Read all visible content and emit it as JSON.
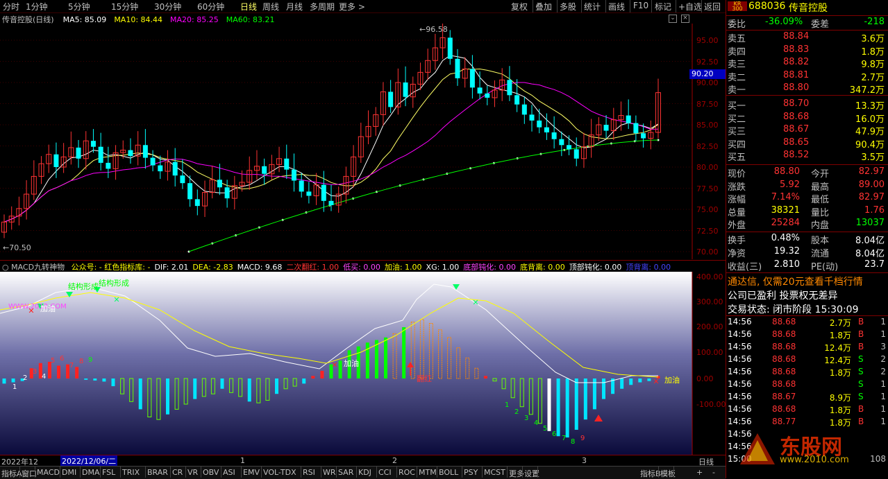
{
  "menu": {
    "periods": [
      "分时",
      "1分钟",
      "5分钟",
      "15分钟",
      "30分钟",
      "60分钟",
      "日线",
      "周线",
      "月线",
      "多周期",
      "更多 >"
    ],
    "active": "日线",
    "right_buttons": [
      "复权",
      "叠加",
      "多股",
      "统计",
      "画线",
      "F10",
      "标记",
      "+自选",
      "返回"
    ]
  },
  "main_chart": {
    "title": "传音控股(日线)",
    "ma": [
      {
        "label": "MA5: 85.09",
        "color": "#ffffff"
      },
      {
        "label": "MA10: 84.44",
        "color": "#ffff00"
      },
      {
        "label": "MA20: 85.25",
        "color": "#ff00ff"
      },
      {
        "label": "MA60: 83.21",
        "color": "#00ff00"
      }
    ],
    "high_label": "96.58",
    "low_label": "70.50",
    "price_tag": "90.20",
    "y_ticks": [
      "95.00",
      "92.50",
      "90.00",
      "87.50",
      "85.00",
      "82.50",
      "80.00",
      "77.50",
      "75.00",
      "72.50",
      "70.00"
    ]
  },
  "indicator": {
    "name": "MACD九转神物",
    "items": [
      {
        "text": "公众号: - 红色指标库: -",
        "color": "#ffff00"
      },
      {
        "text": "DIF: 2.01",
        "color": "#ffffff"
      },
      {
        "text": "DEA: -2.83",
        "color": "#ffff00"
      },
      {
        "text": "MACD: 9.68",
        "color": "#ffffff"
      },
      {
        "text": "二次翻红: 1.00",
        "color": "#ff3333"
      },
      {
        "text": "低买: 0.00",
        "color": "#ff44ff"
      },
      {
        "text": "加油: 1.00",
        "color": "#ffff00"
      },
      {
        "text": "XG: 1.00",
        "color": "#ffffff"
      },
      {
        "text": "底部钝化: 0.00",
        "color": "#ff44ff"
      },
      {
        "text": "底背离: 0.00",
        "color": "#ffff00"
      },
      {
        "text": "顶部钝化: 0.00",
        "color": "#ffffff"
      },
      {
        "text": "顶背离: 0.00",
        "color": "#4444ff"
      }
    ],
    "y_ticks": [
      "400.00",
      "300.00",
      "200.00",
      "100.00",
      "0.00",
      "-100.00"
    ],
    "annotations": {
      "structure1": "结构形成",
      "structure2": "结构形成",
      "watermark": "WWW.2012.COM",
      "jiayou": "加油",
      "fanhong": "翻红"
    },
    "nine_left": [
      "1",
      "2",
      "3",
      "4",
      "5",
      "6",
      "7",
      "8",
      "9"
    ],
    "nine_right": [
      "1",
      "2",
      "3",
      "4",
      "5",
      "6",
      "7",
      "8",
      "9"
    ]
  },
  "x_axis": {
    "labels": [
      "2022年12",
      "2022/12/06/二",
      "1",
      "2",
      "3"
    ],
    "period": "日线"
  },
  "bottom_tabs": [
    "指标A",
    "窗口",
    "MACD",
    "DMI",
    "DMA",
    "FSL",
    "TRIX",
    "BRAR",
    "CR",
    "VR",
    "OBV",
    "ASI",
    "EMV",
    "VOL-TDX",
    "RSI",
    "WR",
    "SAR",
    "KDJ",
    "CCI",
    "ROC",
    "MTM",
    "BOLL",
    "PSY",
    "MCST",
    "更多",
    "设置",
    "指标B",
    "模板"
  ],
  "quote": {
    "badge_top": "KR",
    "badge_bottom": "300",
    "code": "688036",
    "name": "传音控股",
    "weibi_label": "委比",
    "weibi": "-36.09%",
    "weicha_label": "委差",
    "weicha": "-218",
    "asks": [
      {
        "label": "卖五",
        "price": "88.84",
        "vol": "3.6万"
      },
      {
        "label": "卖四",
        "price": "88.83",
        "vol": "1.8万"
      },
      {
        "label": "卖三",
        "price": "88.82",
        "vol": "9.8万"
      },
      {
        "label": "卖二",
        "price": "88.81",
        "vol": "2.7万"
      },
      {
        "label": "卖一",
        "price": "88.80",
        "vol": "347.2万"
      }
    ],
    "bids": [
      {
        "label": "买一",
        "price": "88.70",
        "vol": "13.3万"
      },
      {
        "label": "买二",
        "price": "88.68",
        "vol": "16.0万"
      },
      {
        "label": "买三",
        "price": "88.67",
        "vol": "47.9万"
      },
      {
        "label": "买四",
        "price": "88.65",
        "vol": "90.4万"
      },
      {
        "label": "买五",
        "price": "88.52",
        "vol": "3.5万"
      }
    ],
    "stats": [
      {
        "l1": "现价",
        "v1": "88.80",
        "c1": "#ff3333",
        "l2": "今开",
        "v2": "82.97",
        "c2": "#ff3333"
      },
      {
        "l1": "涨跌",
        "v1": "5.92",
        "c1": "#ff3333",
        "l2": "最高",
        "v2": "89.00",
        "c2": "#ff3333"
      },
      {
        "l1": "涨幅",
        "v1": "7.14%",
        "c1": "#ff3333",
        "l2": "最低",
        "v2": "82.97",
        "c2": "#ff3333"
      },
      {
        "l1": "总量",
        "v1": "38321",
        "c1": "#ffff00",
        "l2": "量比",
        "v2": "1.76",
        "c2": "#ff3333"
      },
      {
        "l1": "外盘",
        "v1": "25284",
        "c1": "#ff3333",
        "l2": "内盘",
        "v2": "13037",
        "c2": "#00ff00"
      }
    ],
    "stats2": [
      {
        "l1": "换手",
        "v1": "0.48%",
        "l2": "股本",
        "v2": "8.04亿"
      },
      {
        "l1": "净资",
        "v1": "19.32",
        "l2": "流通",
        "v2": "8.04亿"
      },
      {
        "l1": "收益(三)",
        "v1": "2.810",
        "l2": "PE(动)",
        "v2": "23.7"
      }
    ],
    "notice": "通达信, 仅需20元查看千档行情",
    "profit": "公司已盈利 投票权无差异",
    "status": "交易状态: 闭市阶段 15:30:09",
    "ticks": [
      {
        "t": "14:56",
        "p": "88.68",
        "v": "2.7万",
        "s": "B",
        "n": "1"
      },
      {
        "t": "14:56",
        "p": "88.68",
        "v": "1.8万",
        "s": "B",
        "n": "1"
      },
      {
        "t": "14:56",
        "p": "88.68",
        "v": "12.4万",
        "s": "B",
        "n": "3"
      },
      {
        "t": "14:56",
        "p": "88.68",
        "v": "12.4万",
        "s": "S",
        "n": "2"
      },
      {
        "t": "14:56",
        "p": "88.68",
        "v": "1.8万",
        "s": "S",
        "n": "2"
      },
      {
        "t": "14:56",
        "p": "88.68",
        "v": "",
        "s": "S",
        "n": "1"
      },
      {
        "t": "14:56",
        "p": "88.67",
        "v": "8.9万",
        "s": "S",
        "n": "1"
      },
      {
        "t": "14:56",
        "p": "88.68",
        "v": "1.8万",
        "s": "B",
        "n": "1"
      },
      {
        "t": "14:56",
        "p": "88.77",
        "v": "1.8万",
        "s": "B",
        "n": "1"
      },
      {
        "t": "14:56",
        "p": "",
        "v": "",
        "s": "",
        "n": ""
      },
      {
        "t": "14:56",
        "p": "",
        "v": "",
        "s": "",
        "n": ""
      },
      {
        "t": "15:00",
        "p": "",
        "v": "",
        "s": "",
        "n": "108"
      }
    ],
    "watermark": "www.2010.com",
    "logo_text": "东股网"
  },
  "colors": {
    "up": "#ff3333",
    "down": "#00ffff",
    "axis": "#a00000",
    "bg": "#000000"
  }
}
